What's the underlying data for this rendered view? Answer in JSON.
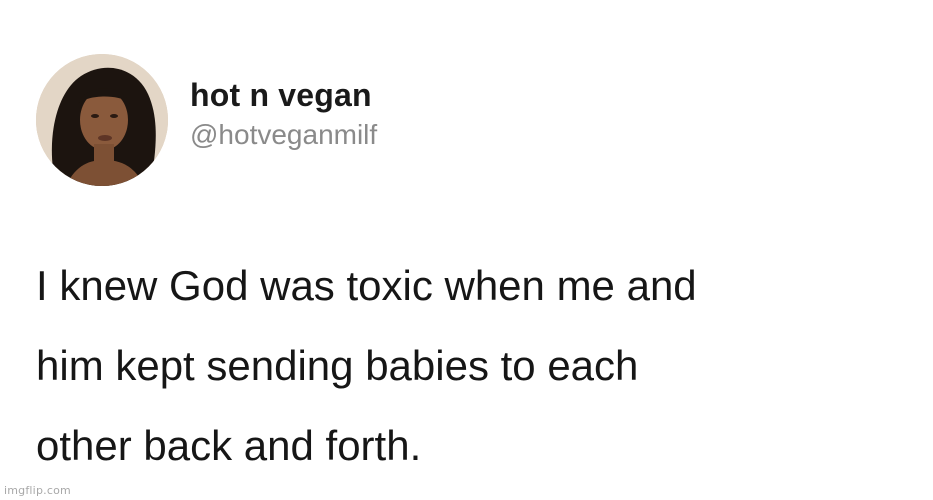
{
  "tweet": {
    "author": {
      "display_name": "hot n vegan",
      "handle": "@hotveganmilf",
      "avatar_icon": "profile-photo"
    },
    "text_lines": [
      "I knew God was toxic when me and",
      "him kept sending babies to each",
      "other back and forth."
    ]
  },
  "watermark": "imgflip.com"
}
